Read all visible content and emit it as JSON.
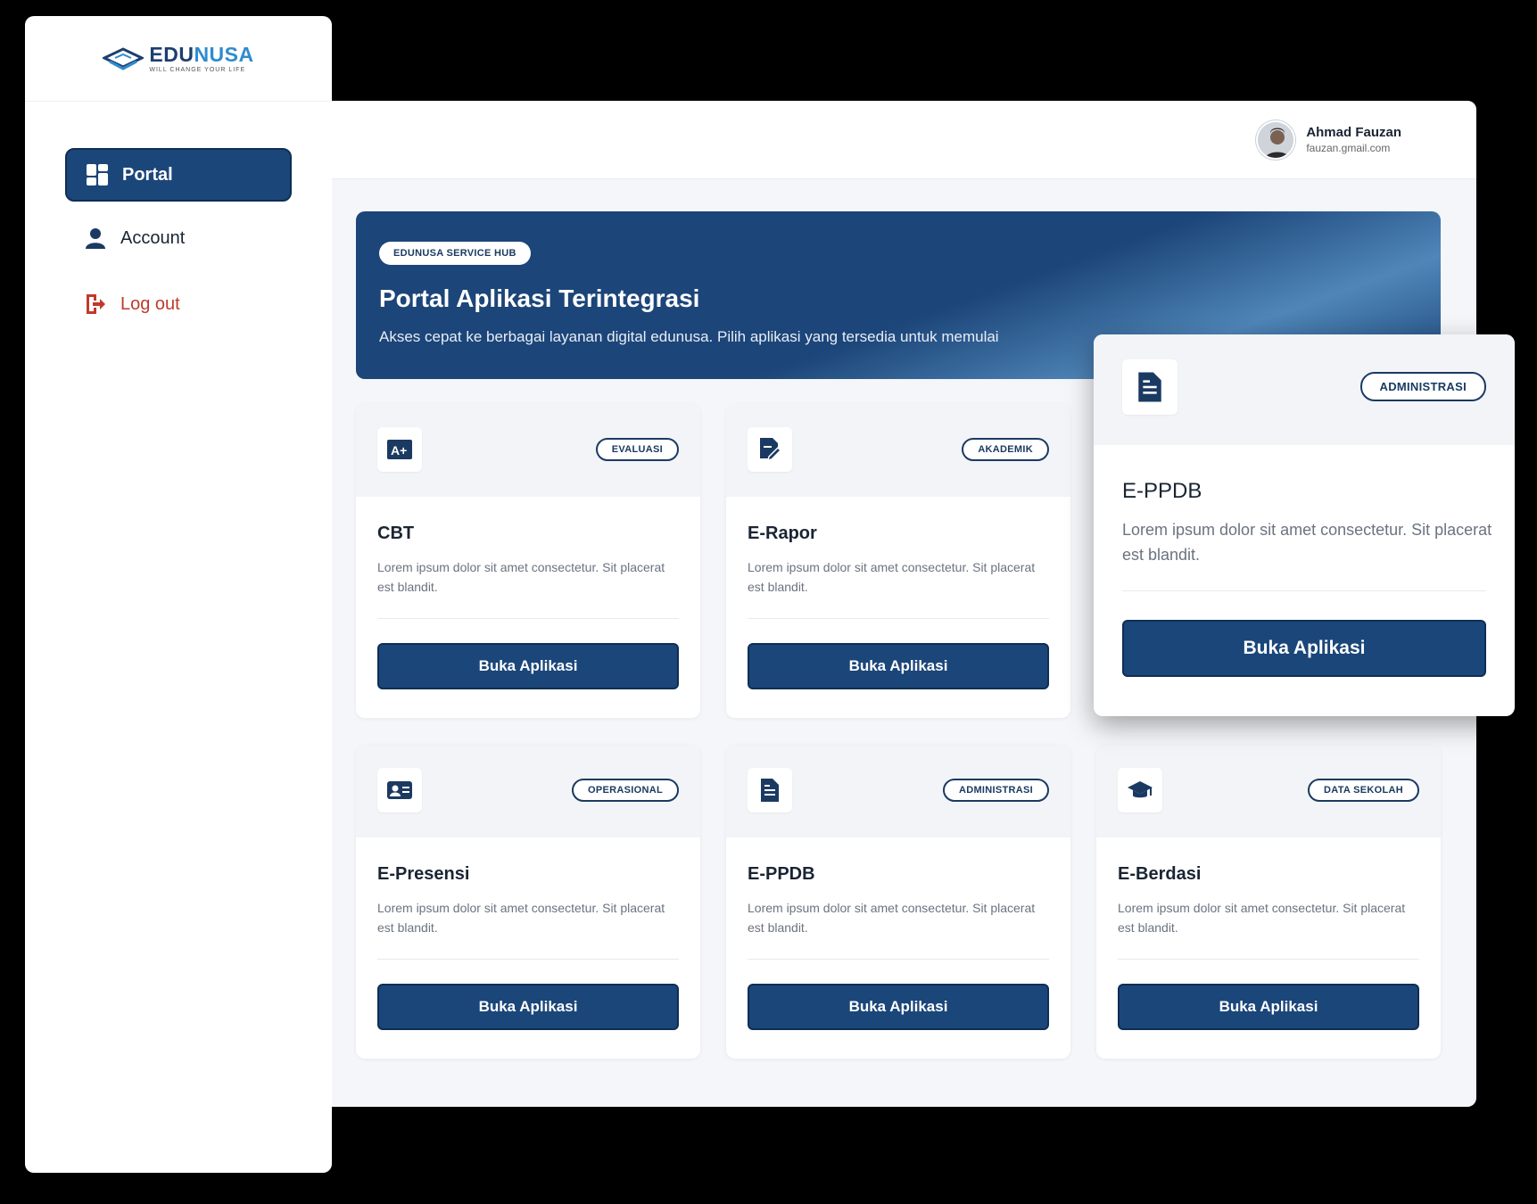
{
  "brand": {
    "name_part1": "EDU",
    "name_part2": "NUSA",
    "tagline": "WILL CHANGE YOUR LIFE"
  },
  "sidebar": {
    "items": [
      {
        "label": "Portal",
        "icon": "grid-icon",
        "active": true
      },
      {
        "label": "Account",
        "icon": "user-icon",
        "active": false
      },
      {
        "label": "Log out",
        "icon": "logout-icon",
        "active": false
      }
    ]
  },
  "user": {
    "name": "Ahmad Fauzan",
    "email": "fauzan.gmail.com"
  },
  "banner": {
    "badge": "EDUNUSA SERVICE HUB",
    "title": "Portal Aplikasi Terintegrasi",
    "subtitle": "Akses cepat ke berbagai layanan digital edunusa. Pilih aplikasi yang tersedia untuk memulai"
  },
  "cards": [
    {
      "title": "CBT",
      "badge": "EVALUASI",
      "icon": "grade-icon",
      "desc": "Lorem ipsum dolor sit amet consectetur. Sit placerat est blandit.",
      "button": "Buka Aplikasi"
    },
    {
      "title": "E-Rapor",
      "badge": "AKADEMIK",
      "icon": "edit-document-icon",
      "desc": "Lorem ipsum dolor sit amet consectetur. Sit placerat est blandit.",
      "button": "Buka Aplikasi"
    },
    {
      "title": "E-Presensi",
      "badge": "OPERASIONAL",
      "icon": "id-card-icon",
      "desc": "Lorem ipsum dolor sit amet consectetur. Sit placerat est blandit.",
      "button": "Buka Aplikasi"
    },
    {
      "title": "E-PPDB",
      "badge": "ADMINISTRASI",
      "icon": "document-icon",
      "desc": "Lorem ipsum dolor sit amet consectetur. Sit placerat est blandit.",
      "button": "Buka Aplikasi"
    },
    {
      "title": "E-Berdasi",
      "badge": "DATA SEKOLAH",
      "icon": "graduation-cap-icon",
      "desc": "Lorem ipsum dolor sit amet consectetur. Sit placerat est blandit.",
      "button": "Buka Aplikasi"
    }
  ],
  "featured": {
    "title": "E-PPDB",
    "badge": "ADMINISTRASI",
    "icon": "document-icon",
    "desc": "Lorem ipsum dolor sit amet consectetur. Sit placerat est blandit.",
    "button": "Buka Aplikasi"
  },
  "colors": {
    "primary": "#1b4679",
    "accent": "#2e8ccf",
    "danger": "#c0392b"
  }
}
